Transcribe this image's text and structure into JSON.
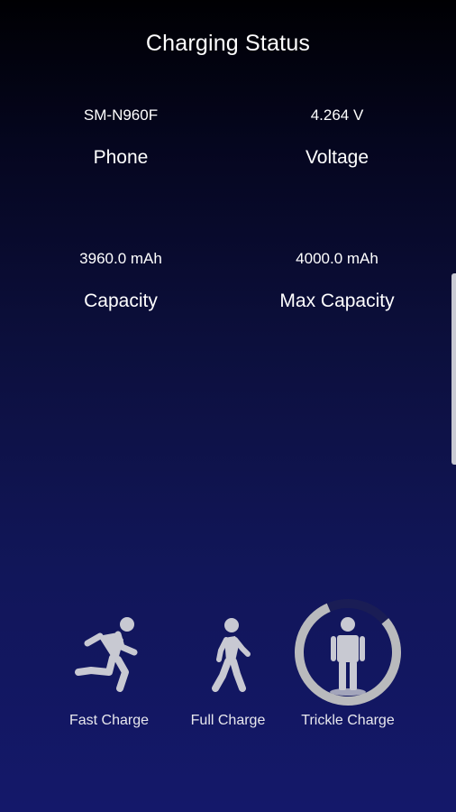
{
  "header": {
    "title": "Charging Status"
  },
  "stats": {
    "phone": {
      "value": "SM-N960F",
      "label": "Phone"
    },
    "voltage": {
      "value": "4.264 V",
      "label": "Voltage"
    },
    "capacity": {
      "value": "3960.0 mAh",
      "label": "Capacity"
    },
    "max_capacity": {
      "value": "4000.0 mAh",
      "label": "Max Capacity"
    }
  },
  "modes": [
    {
      "label": "Fast Charge",
      "icon": "running-person-icon",
      "active": false
    },
    {
      "label": "Full Charge",
      "icon": "walking-person-icon",
      "active": false
    },
    {
      "label": "Trickle Charge",
      "icon": "standing-person-icon",
      "active": true
    }
  ],
  "colors": {
    "background_top": "#000003",
    "background_bottom": "#14186a",
    "icon": "#c8c9d2",
    "ring": "#b9babd"
  }
}
